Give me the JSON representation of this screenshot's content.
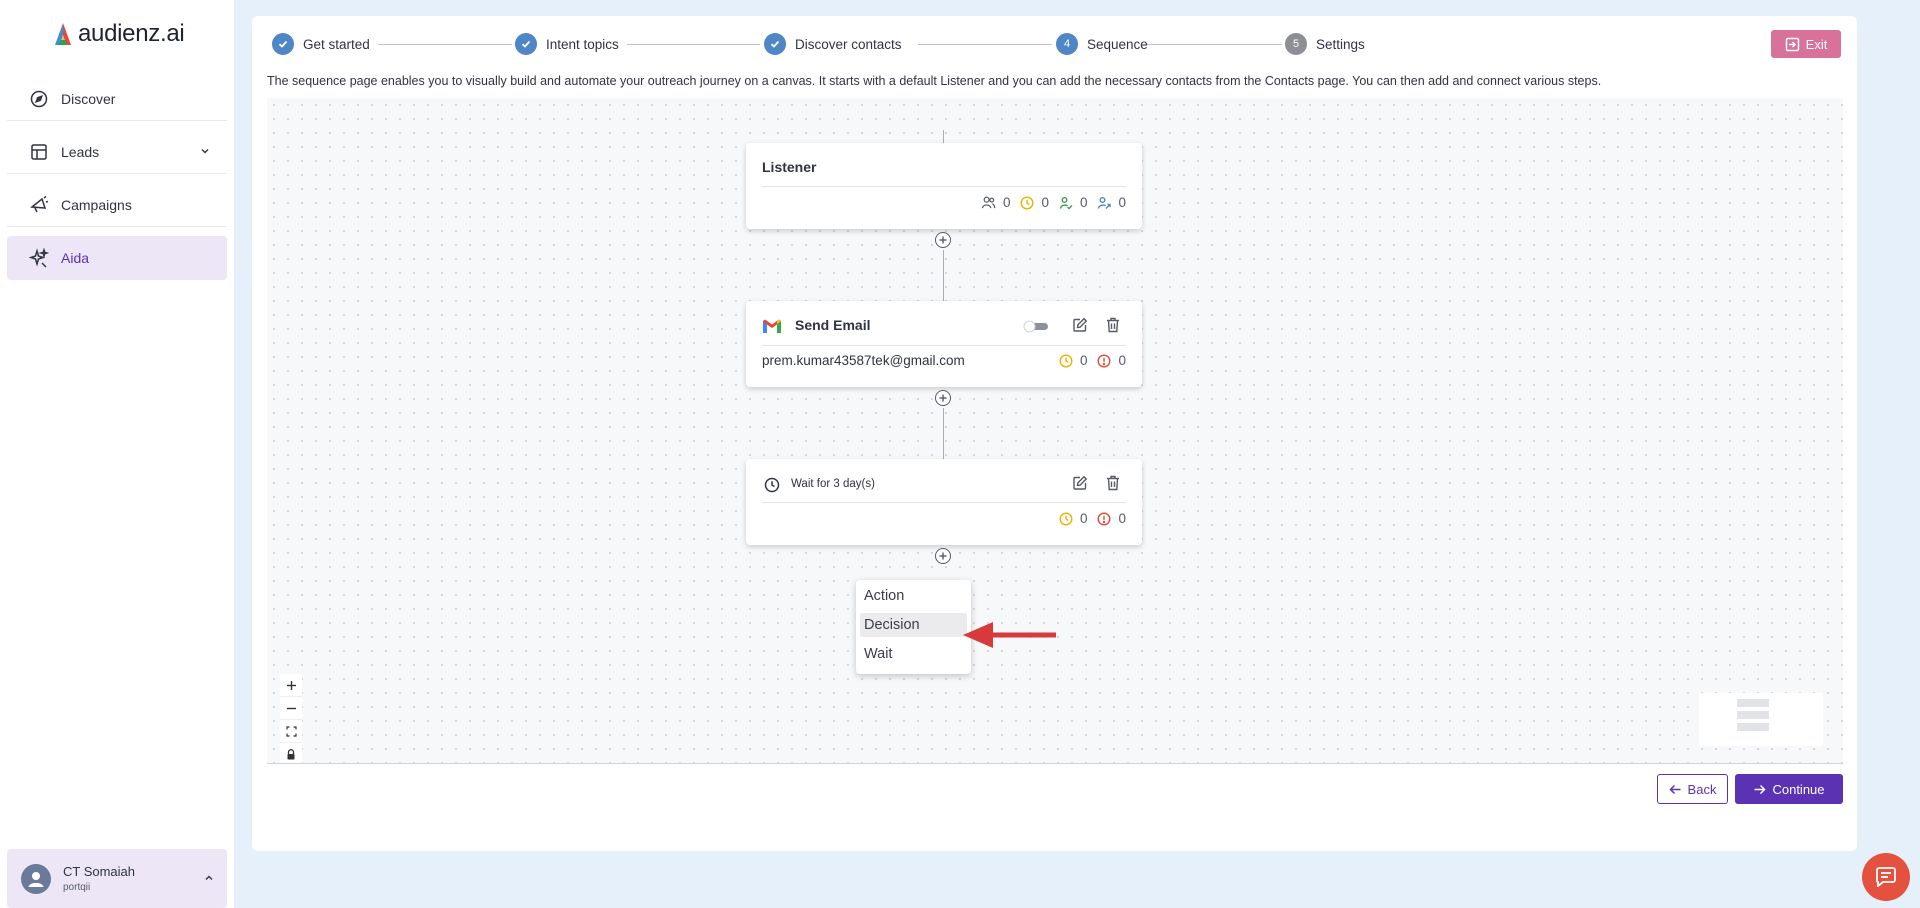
{
  "app": {
    "logo_text": "audienz.ai"
  },
  "sidebar": {
    "items": [
      {
        "label": "Discover",
        "icon": "compass-icon"
      },
      {
        "label": "Leads",
        "icon": "layout-icon"
      },
      {
        "label": "Campaigns",
        "icon": "megaphone-icon"
      },
      {
        "label": "Aida",
        "icon": "sparkles-icon"
      }
    ],
    "active": "Aida",
    "user": {
      "name": "CT Somaiah",
      "org": "portqii"
    }
  },
  "stepper": {
    "steps": [
      {
        "label": "Get started",
        "state": "done"
      },
      {
        "label": "Intent topics",
        "state": "done"
      },
      {
        "label": "Discover contacts",
        "state": "done"
      },
      {
        "label": "Sequence",
        "state": "current",
        "number": "4"
      },
      {
        "label": "Settings",
        "state": "upcoming",
        "number": "5"
      }
    ],
    "exit_label": "Exit"
  },
  "description": "The sequence page enables you to visually build and automate your outreach journey on a canvas. It starts with a default Listener and you can add the necessary contacts from the Contacts page. You can then add and connect various steps.",
  "canvas": {
    "listener": {
      "title": "Listener",
      "stats": [
        {
          "icon": "users-icon",
          "value": "0",
          "color": "#555a66"
        },
        {
          "icon": "clock-icon",
          "value": "0",
          "color": "#e8b400"
        },
        {
          "icon": "user-check-icon",
          "value": "0",
          "color": "#3f9a4d"
        },
        {
          "icon": "user-share-icon",
          "value": "0",
          "color": "#4f86c6"
        }
      ]
    },
    "send_email": {
      "title": "Send Email",
      "email": "prem.kumar43587tek@gmail.com",
      "stats": [
        {
          "icon": "clock-icon",
          "value": "0",
          "color": "#e8b400"
        },
        {
          "icon": "alert-circle-icon",
          "value": "0",
          "color": "#e24a3b"
        }
      ]
    },
    "wait": {
      "title": "Wait for 3 day(s)",
      "stats": [
        {
          "icon": "clock-icon",
          "value": "0",
          "color": "#e8b400"
        },
        {
          "icon": "alert-circle-icon",
          "value": "0",
          "color": "#e24a3b"
        }
      ]
    },
    "add_menu": {
      "items": [
        "Action",
        "Decision",
        "Wait"
      ],
      "highlighted": "Decision"
    },
    "zoom_controls": [
      "+",
      "−",
      "⛶",
      "🔒"
    ]
  },
  "footer": {
    "back_label": "Back",
    "continue_label": "Continue"
  },
  "colors": {
    "primary": "#5b32b4",
    "exit": "#d9729a",
    "step_done": "#4f86c6",
    "arrow": "#d63a3a",
    "chat": "#e4513f"
  }
}
